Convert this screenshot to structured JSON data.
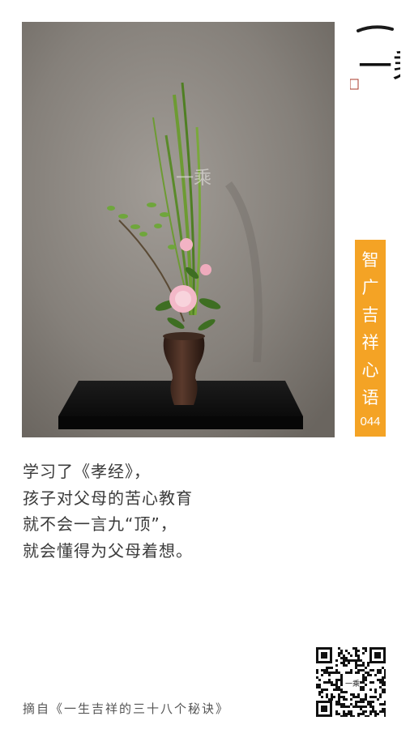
{
  "photo": {
    "watermark": "一乘"
  },
  "logo": {
    "text": "一乘",
    "seal": "印"
  },
  "badge": {
    "chars": [
      "智",
      "广",
      "吉",
      "祥",
      "心",
      "语"
    ],
    "number": "044",
    "color": "#f4a325"
  },
  "quote": {
    "lines": [
      "学习了《孝经》，",
      "孩子对父母的苦心教育",
      "就不会一言九“顶”，",
      "就会懂得为父母着想。"
    ]
  },
  "source": {
    "text": "摘自《一生吉祥的三十八个秘诀》"
  },
  "qr": {
    "center_text": "一乘"
  }
}
